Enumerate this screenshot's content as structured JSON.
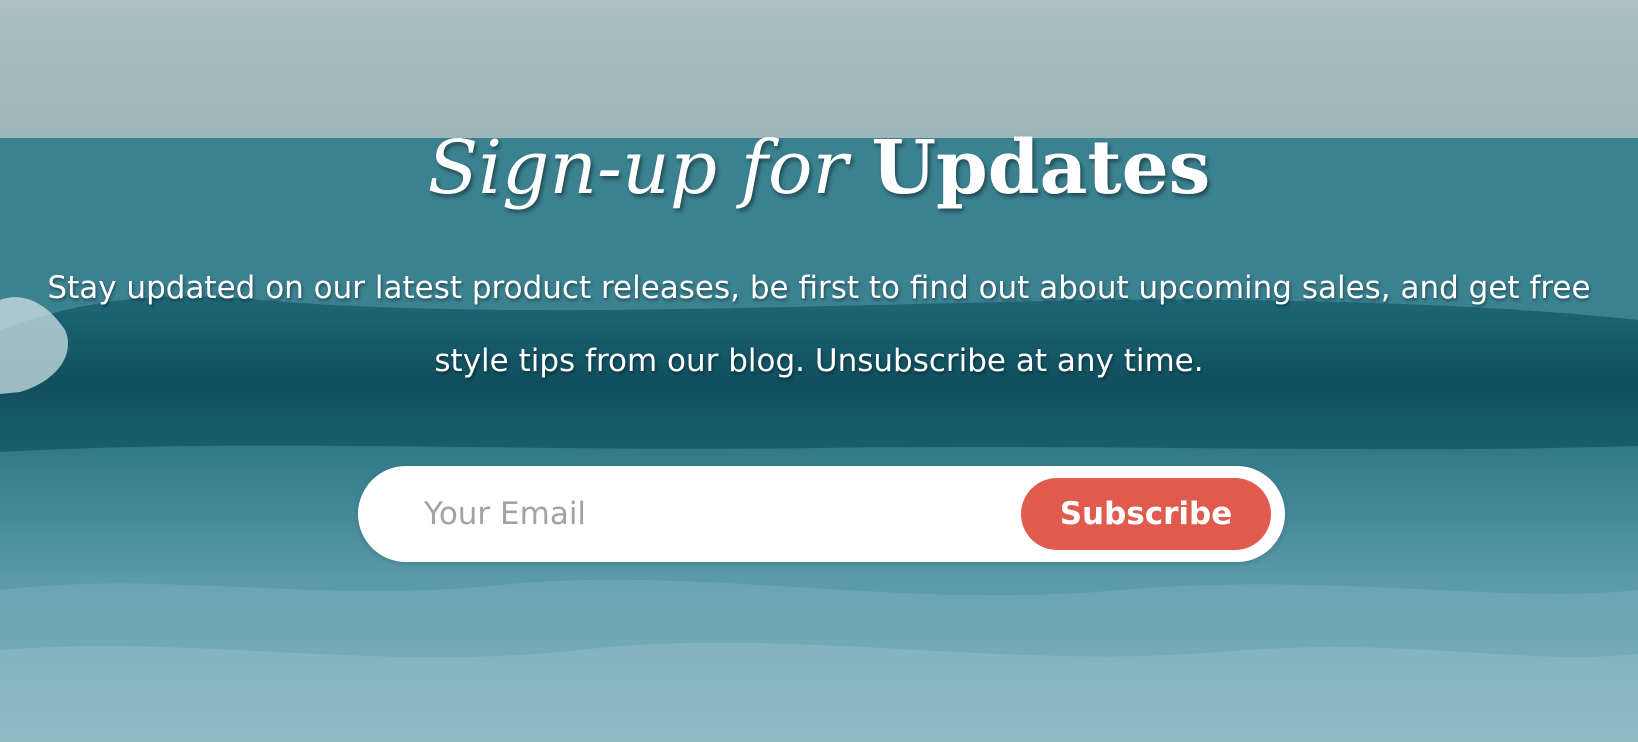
{
  "section": {
    "title_italic": "Sign-up for",
    "title_bold": "Updates",
    "description": "Stay updated on our latest product releases, be first to find out about upcoming sales, and get free style tips from our blog. Unsubscribe at any time."
  },
  "form": {
    "email_placeholder": "Your Email",
    "email_value": "",
    "subscribe_label": "Subscribe"
  },
  "colors": {
    "button": "#e05a4d",
    "input_background": "#ffffff",
    "text": "#ffffff"
  },
  "background": {
    "image": "ocean-wave-image"
  }
}
